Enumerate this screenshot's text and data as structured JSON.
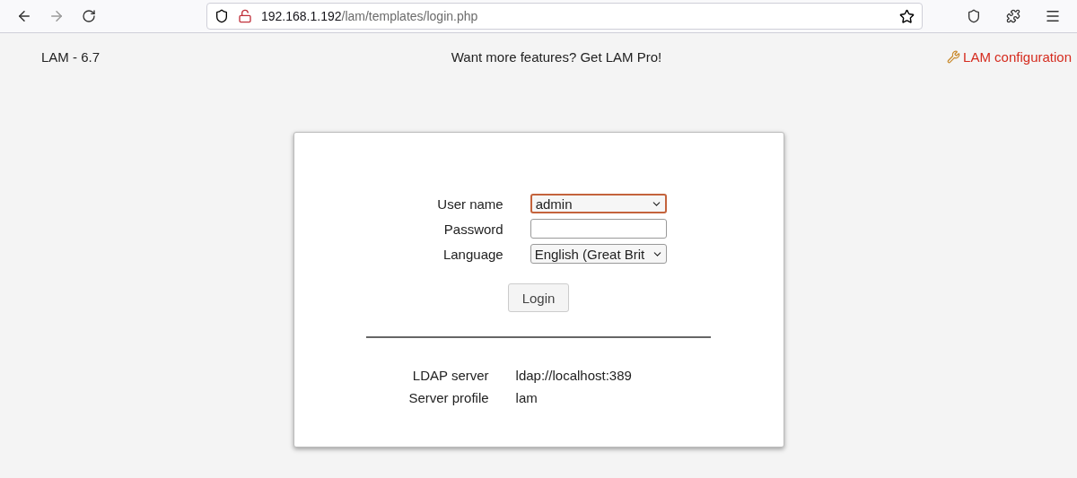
{
  "browser": {
    "url_host": "192.168.1.192",
    "url_path": "/lam/templates/login.php"
  },
  "header": {
    "version": "LAM - 6.7",
    "promo": "Want more features? Get LAM Pro!",
    "config_link": "LAM configuration"
  },
  "login_form": {
    "fields": [
      {
        "label": "User name",
        "kind": "select",
        "value": "admin",
        "focused": true
      },
      {
        "label": "Password",
        "kind": "password",
        "focused": false
      },
      {
        "label": "Language",
        "kind": "select",
        "value": "English (Great Brit",
        "focused": false
      }
    ],
    "button": "Login"
  },
  "server_info": [
    {
      "label": "LDAP server",
      "value": "ldap://localhost:389"
    },
    {
      "label": "Server profile",
      "value": "lam"
    }
  ]
}
